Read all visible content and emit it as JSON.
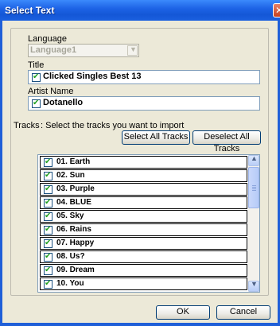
{
  "window": {
    "title": "Select Text"
  },
  "language": {
    "label": "Language",
    "value": "Language1"
  },
  "title": {
    "label": "Title",
    "value": "Clicked Singles Best 13",
    "checked": true
  },
  "artist": {
    "label": "Artist Name",
    "value": "Dotanello",
    "checked": true
  },
  "tracks": {
    "label": "Tracks",
    "instruction": ": Select the tracks you want to import",
    "select_all": "Select All Tracks",
    "deselect_all": "Deselect All Tracks",
    "items": [
      {
        "label": "01. Earth",
        "checked": true
      },
      {
        "label": "02. Sun",
        "checked": true
      },
      {
        "label": "03. Purple",
        "checked": true
      },
      {
        "label": "04. BLUE",
        "checked": true
      },
      {
        "label": "05. Sky",
        "checked": true
      },
      {
        "label": "06. Rains",
        "checked": true
      },
      {
        "label": "07. Happy",
        "checked": true
      },
      {
        "label": "08. Us?",
        "checked": true
      },
      {
        "label": "09. Dream",
        "checked": true
      },
      {
        "label": "10. You",
        "checked": true
      }
    ]
  },
  "buttons": {
    "ok": "OK",
    "cancel": "Cancel"
  },
  "glyphs": {
    "check": "✔",
    "close": "✕",
    "combo_arrow": "▼",
    "scroll_up": "▲",
    "scroll_down": "▼"
  }
}
